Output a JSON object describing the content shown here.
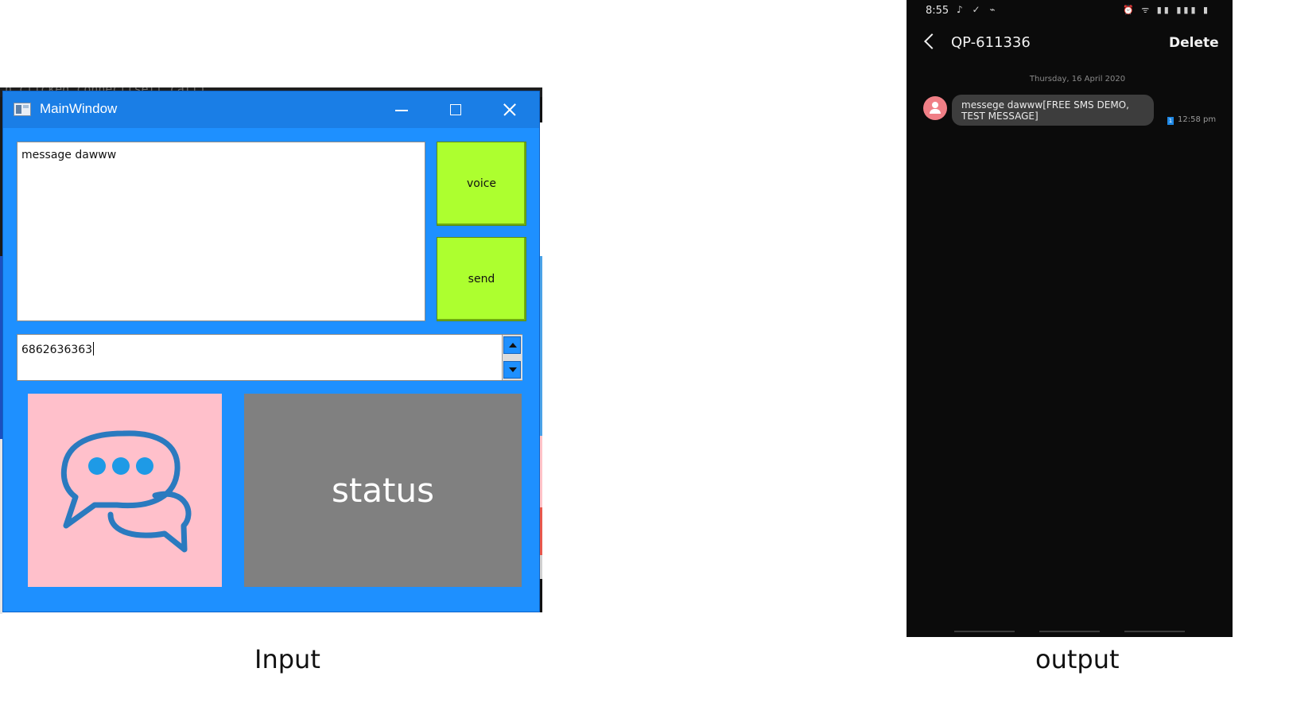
{
  "input_window": {
    "background_code": "h.clicked.connect(self.call)",
    "title": "MainWindow",
    "message_text": "message dawww",
    "voice_label": "voice",
    "send_label": "send",
    "phone_number": "6862636363",
    "status_label": "status"
  },
  "captions": {
    "input": "Input",
    "output": "output"
  },
  "phone": {
    "status_bar": {
      "time": "8:55",
      "left_icons": "♪ ✓ ⌁",
      "right_icons": "⏰ ᯤ ▮▮ ▮▮▮ ▮"
    },
    "header": {
      "contact": "QP-611336",
      "delete_label": "Delete"
    },
    "date_separator": "Thursday, 16 April 2020",
    "message": {
      "text": "messege dawww[FREE SMS DEMO, TEST MESSAGE]",
      "sim": "1",
      "time": "12:58 pm"
    }
  },
  "colors": {
    "window_bg": "#1e90ff",
    "button_green": "#adff2f",
    "image_bg": "#ffc0cb",
    "status_bg": "#808080",
    "chat_icon_stroke": "#2a7abf",
    "chat_dots": "#1e9ae6",
    "phone_bg": "#0b0b0b"
  }
}
